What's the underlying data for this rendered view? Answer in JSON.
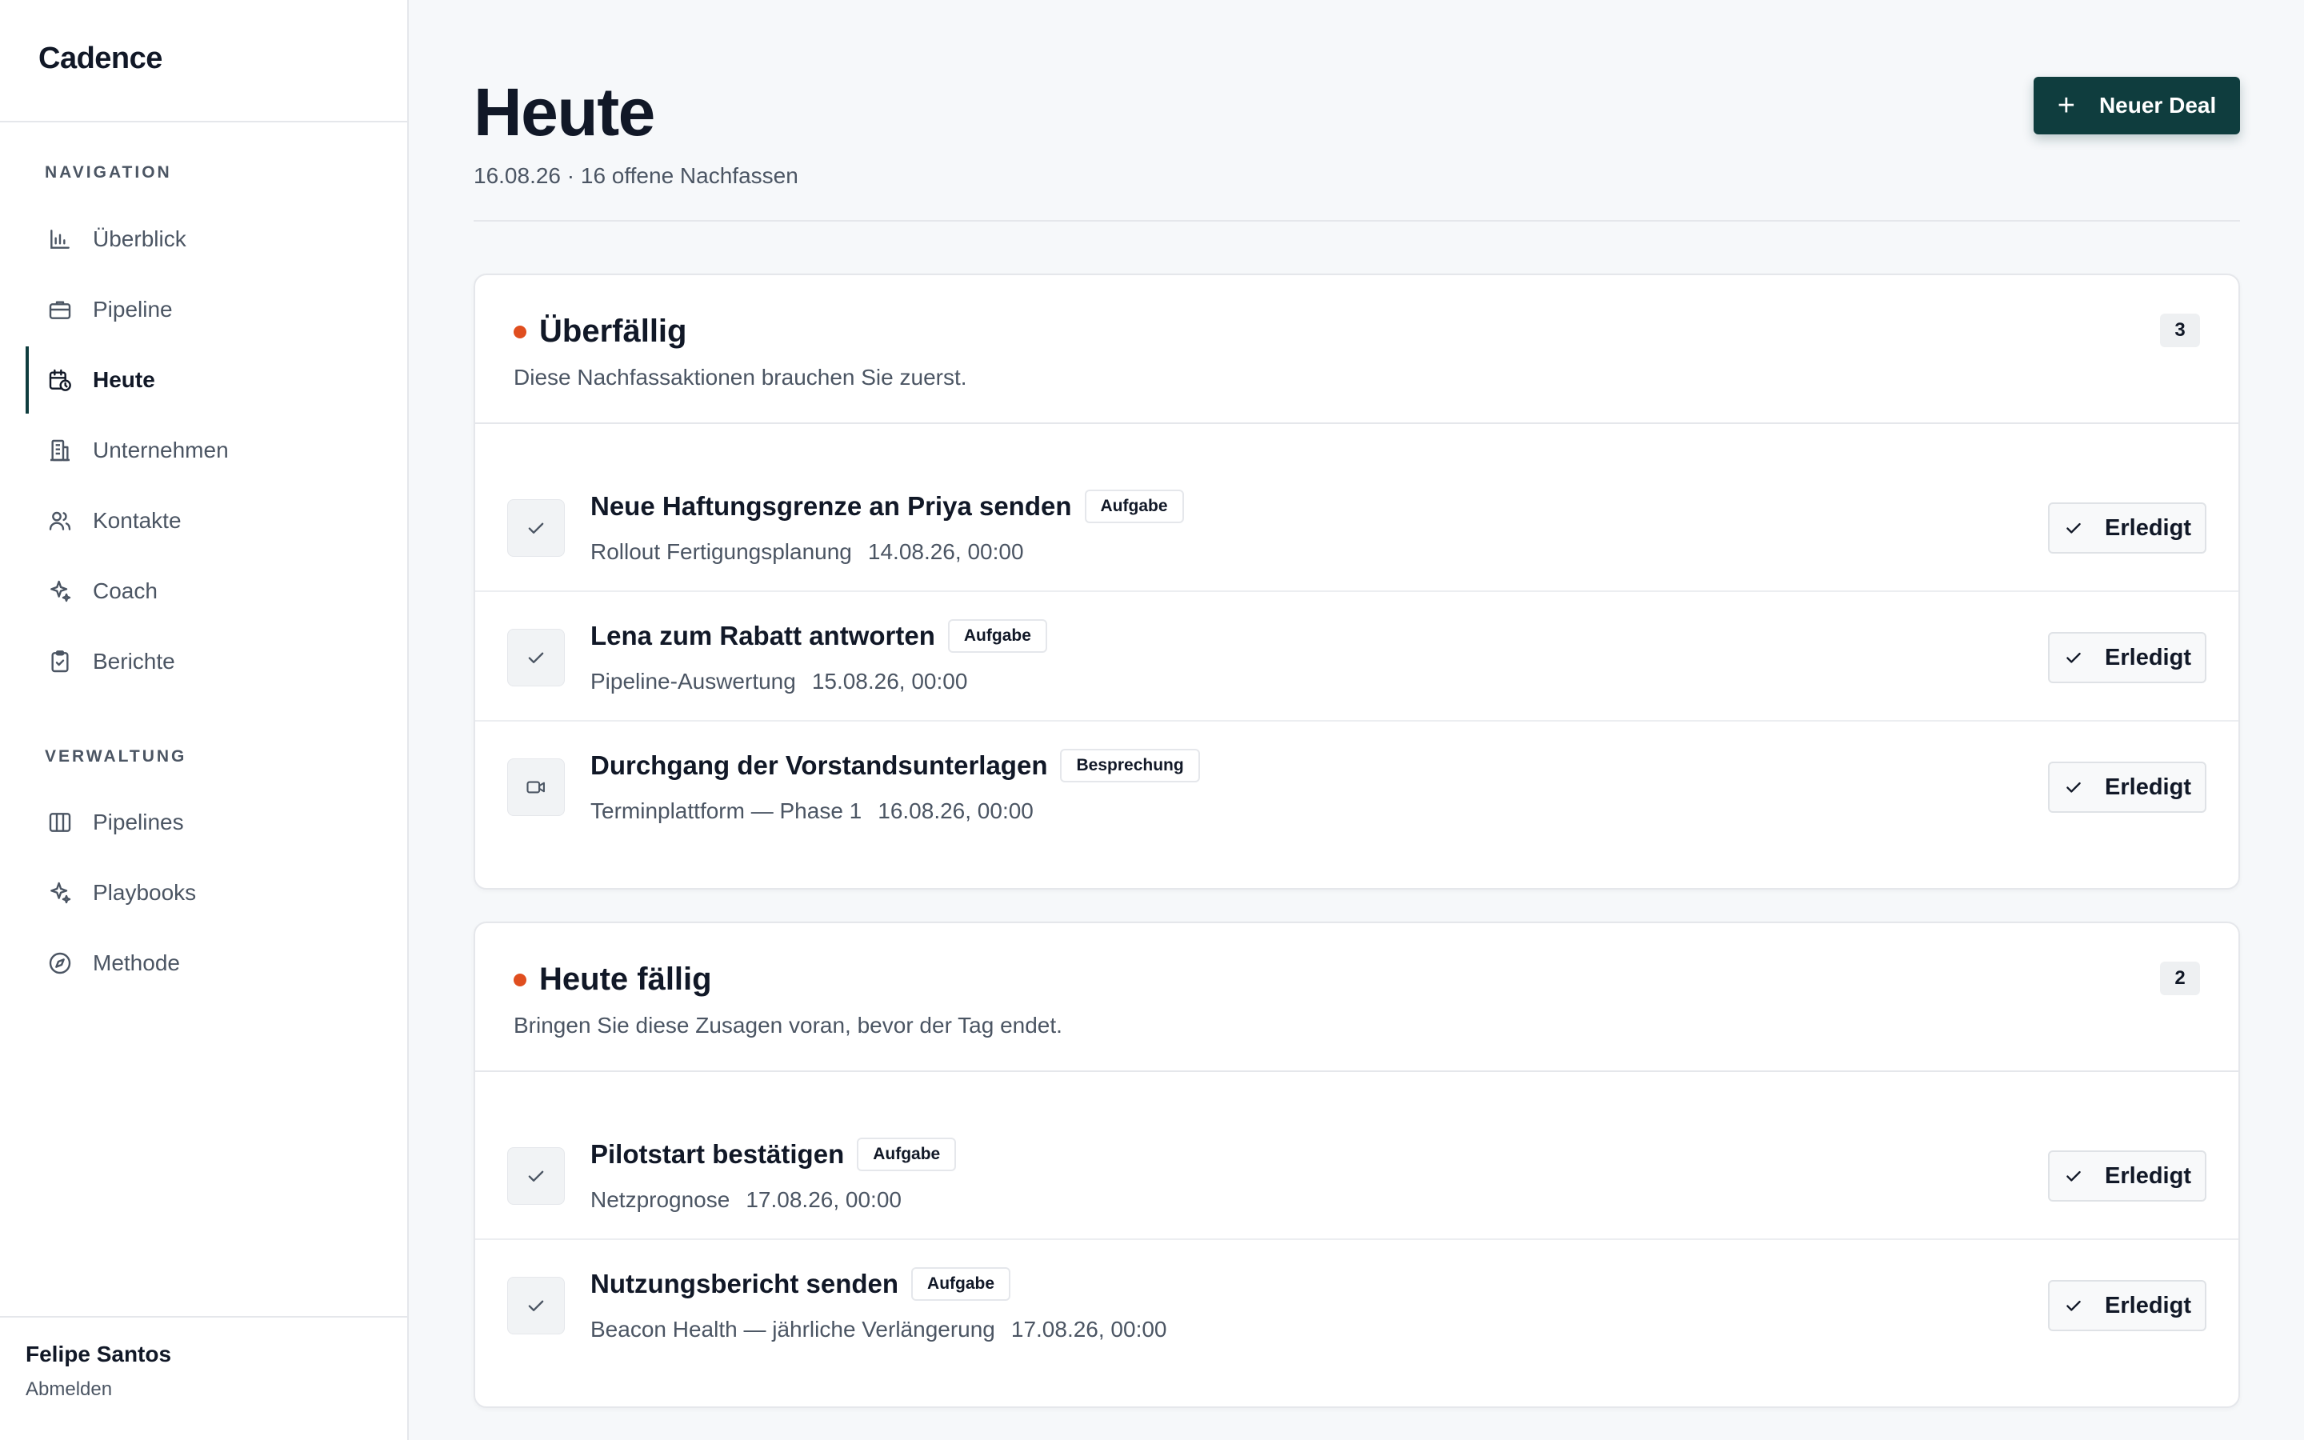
{
  "app": {
    "brand": "Cadence"
  },
  "sidebar": {
    "section_nav": "NAVIGATION",
    "nav_items": [
      {
        "label": "Überblick",
        "icon": "bar-chart-icon"
      },
      {
        "label": "Pipeline",
        "icon": "briefcase-icon"
      },
      {
        "label": "Heute",
        "icon": "calendar-clock-icon",
        "active": true
      },
      {
        "label": "Unternehmen",
        "icon": "building-icon"
      },
      {
        "label": "Kontakte",
        "icon": "users-icon"
      },
      {
        "label": "Coach",
        "icon": "sparkles-icon"
      },
      {
        "label": "Berichte",
        "icon": "clipboard-check-icon"
      }
    ],
    "section_admin": "VERWALTUNG",
    "admin_items": [
      {
        "label": "Pipelines",
        "icon": "columns-icon"
      },
      {
        "label": "Playbooks",
        "icon": "sparkles-icon"
      },
      {
        "label": "Methode",
        "icon": "compass-icon"
      }
    ],
    "user": {
      "name": "Felipe Santos",
      "logout": "Abmelden"
    }
  },
  "header": {
    "title": "Heute",
    "subtitle": "16.08.26 · 16 offene Nachfassen",
    "new_deal_label": "Neuer Deal",
    "new_deal_icon": "plus-icon"
  },
  "sections": [
    {
      "title": "Überfällig",
      "description": "Diese Nachfassaktionen brauchen Sie zuerst.",
      "count": "3",
      "dot_color": "#e04e1f",
      "items": [
        {
          "title": "Neue Haftungsgrenze an Priya senden",
          "tag": "Aufgabe",
          "deal": "Rollout Fertigungsplanung",
          "date": "14.08.26, 00:00",
          "icon": "check-icon",
          "action": "Erledigt"
        },
        {
          "title": "Lena zum Rabatt antworten",
          "tag": "Aufgabe",
          "deal": "Pipeline-Auswertung",
          "date": "15.08.26, 00:00",
          "icon": "check-icon",
          "action": "Erledigt"
        },
        {
          "title": "Durchgang der Vorstandsunterlagen",
          "tag": "Besprechung",
          "deal": "Terminplattform — Phase 1",
          "date": "16.08.26, 00:00",
          "icon": "video-icon",
          "action": "Erledigt"
        }
      ]
    },
    {
      "title": "Heute fällig",
      "description": "Bringen Sie diese Zusagen voran, bevor der Tag endet.",
      "count": "2",
      "dot_color": "#e04e1f",
      "items": [
        {
          "title": "Pilotstart bestätigen",
          "tag": "Aufgabe",
          "deal": "Netzprognose",
          "date": "17.08.26, 00:00",
          "icon": "check-icon",
          "action": "Erledigt"
        },
        {
          "title": "Nutzungsbericht senden",
          "tag": "Aufgabe",
          "deal": "Beacon Health — jährliche Verlängerung",
          "date": "17.08.26, 00:00",
          "icon": "check-icon",
          "action": "Erledigt"
        }
      ]
    }
  ],
  "colors": {
    "accent": "#0f3d3e",
    "alert_dot": "#e04e1f"
  }
}
